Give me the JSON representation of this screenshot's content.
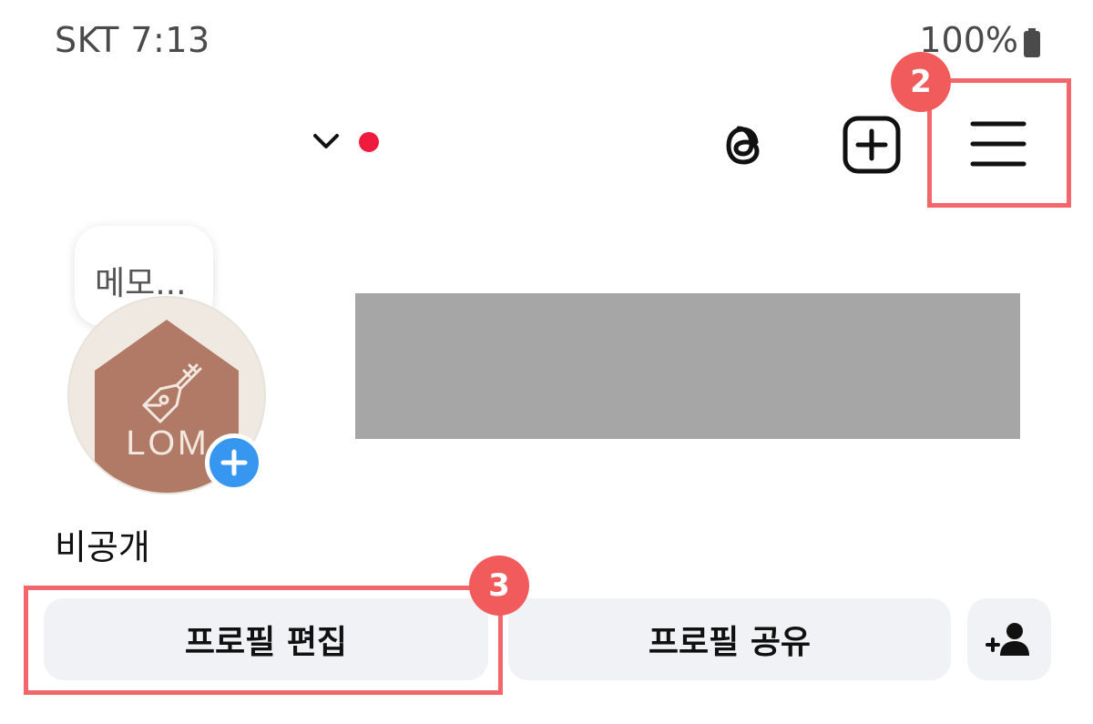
{
  "status_bar": {
    "carrier_time": "SKT 7:13",
    "battery": "100%",
    "battery_icon": "battery-full-icon"
  },
  "top_bar": {
    "account_switcher_icon": "chevron-down-icon",
    "notification_dot_color": "#ef1a3c",
    "threads_icon": "threads-icon",
    "create_icon": "plus-square-icon",
    "menu_icon": "hamburger-menu-icon"
  },
  "annotations": {
    "step_menu": "2",
    "step_edit": "3",
    "highlight_color": "#f2676b",
    "badge_color": "#f15b5b"
  },
  "profile": {
    "memo_placeholder": "메모...",
    "avatar_logo_text": "LOM",
    "add_story_icon": "plus-icon",
    "account_name": "비공개"
  },
  "actions": {
    "edit_profile": "프로필 편집",
    "share_profile": "프로필 공유",
    "add_person_icon": "add-person-icon"
  }
}
